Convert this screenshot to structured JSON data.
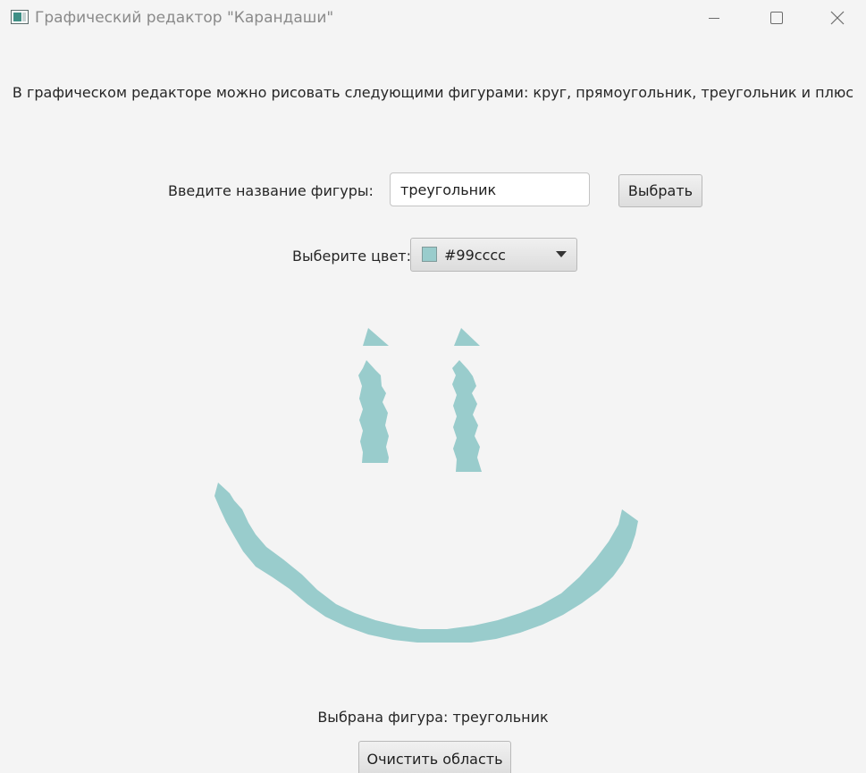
{
  "window": {
    "title": "Графический редактор \"Карандаши\"",
    "icon": "app-icon"
  },
  "description": "В графическом редакторе можно рисовать следующими фигурами: круг, прямоугольник, треугольник и плюс",
  "shape_form": {
    "label": "Введите название фигуры:",
    "input_value": "треугольник",
    "button_label": "Выбрать"
  },
  "color_form": {
    "label": "Выберите цвет:",
    "selected_value": "#99cccc",
    "icon": "chevron-down-icon"
  },
  "canvas": {
    "stroke_color": "#99cccc"
  },
  "status": "Выбрана фигура: треугольник",
  "clear_button_label": "Очистить область",
  "colors": {
    "window_bg": "#f4f4f4",
    "drawing": "#99cccc"
  }
}
